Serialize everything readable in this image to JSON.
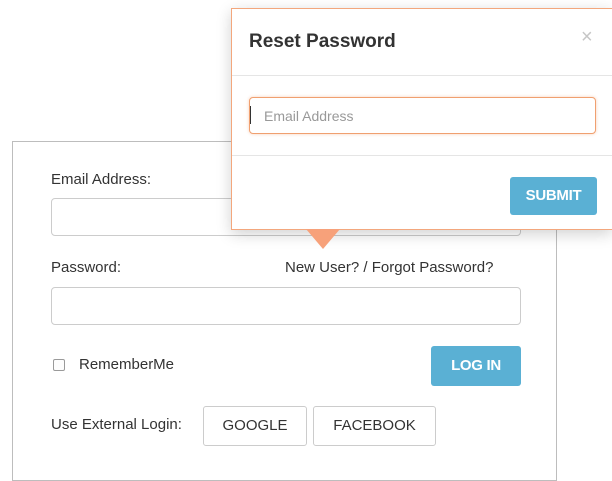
{
  "login": {
    "email_label": "Email Address:",
    "email_value": "",
    "password_label": "Password:",
    "password_value": "",
    "links_text": "New User? / Forgot Password?",
    "remember_label": "RememberMe",
    "remember_checked": false,
    "login_button": "LOG IN",
    "external_label": "Use External Login:",
    "google_button": "GOOGLE",
    "facebook_button": "FACEBOOK"
  },
  "reset_popover": {
    "title": "Reset Password",
    "close_symbol": "×",
    "email_placeholder": "Email Address",
    "email_value": "",
    "submit_button": "SUBMIT"
  },
  "colors": {
    "primary_button": "#5ab0d4",
    "popover_border": "#f3a77d",
    "arrow": "#f7a17a"
  },
  "icons": {
    "close": "close-icon",
    "arrow": "popover-arrow"
  }
}
